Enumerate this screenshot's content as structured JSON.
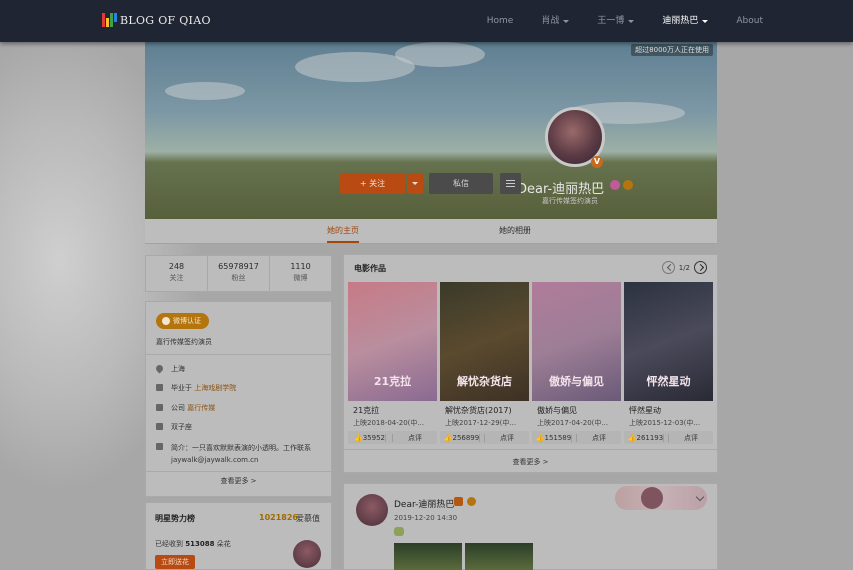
{
  "brand": {
    "title": "BLOG OF QIAO",
    "logo_colors": [
      "#e53935",
      "#fbc02d",
      "#43a047",
      "#1e88e5"
    ]
  },
  "nav": {
    "items": [
      {
        "label": "Home",
        "dropdown": false,
        "active": false
      },
      {
        "label": "肖战",
        "dropdown": true,
        "active": false
      },
      {
        "label": "王一博",
        "dropdown": true,
        "active": false
      },
      {
        "label": "迪丽热巴",
        "dropdown": true,
        "active": true
      },
      {
        "label": "About",
        "dropdown": false,
        "active": false
      }
    ]
  },
  "cover": {
    "badge": "超过8000万人正在使用",
    "name": "Dear-迪丽热巴",
    "subtitle": "嘉行传媒签约演员",
    "follow_label": "+ 关注",
    "message_label": "私信"
  },
  "tabs": [
    {
      "label": "她的主页",
      "active": true
    },
    {
      "label": "她的相册",
      "active": false
    }
  ],
  "stats": [
    {
      "num": "248",
      "label": "关注"
    },
    {
      "num": "65978917",
      "label": "粉丝"
    },
    {
      "num": "1110",
      "label": "微博"
    }
  ],
  "info": {
    "verify_pill": "微博认证",
    "verify_text": "嘉行传媒签约演员",
    "location": "上海",
    "school_prefix": "毕业于",
    "school": "上海戏剧学院",
    "company_prefix": "公司",
    "company": "嘉行传媒",
    "zodiac": "双子座",
    "bio": "简介：一只喜欢默默表演的小透明。工作联系jaywalk@jaywalk.com.cn",
    "more": "查看更多 >"
  },
  "power": {
    "title": "明星势力榜",
    "rank": "1021826",
    "rank_label": "爱慕值",
    "received_prefix": "已经收到",
    "received_count": "513088",
    "received_suffix": "朵花",
    "button": "立即送花"
  },
  "movies": {
    "title": "电影作品",
    "page": "1/2",
    "items": [
      {
        "title": "21克拉",
        "date": "上映2018-04-20(中...",
        "likes": "35952",
        "comment": "点评",
        "poster_text": "21克拉",
        "colors": [
          "#c77a86",
          "#b98e9e",
          "#8a6a92"
        ]
      },
      {
        "title": "解忧杂货店(2017)",
        "date": "上映2017-12-29(中...",
        "likes": "256899",
        "comment": "点评",
        "poster_text": "解忧杂货店",
        "colors": [
          "#3a3a2a",
          "#5a4a2e",
          "#3d3125"
        ]
      },
      {
        "title": "傲娇与偏见",
        "date": "上映2017-04-20(中...",
        "likes": "151589",
        "comment": "点评",
        "poster_text": "傲娇与偏见",
        "colors": [
          "#b07c9a",
          "#9d7e96",
          "#6a5a78"
        ]
      },
      {
        "title": "怦然星动",
        "date": "上映2015-12-03(中...",
        "likes": "261193",
        "comment": "点评",
        "poster_text": "怦然星动",
        "colors": [
          "#2c3240",
          "#4a4a5a",
          "#2a2a36"
        ]
      }
    ],
    "more": "查看更多 >"
  },
  "post": {
    "name": "Dear-迪丽热巴",
    "time": "2019-12-20 14:30"
  }
}
